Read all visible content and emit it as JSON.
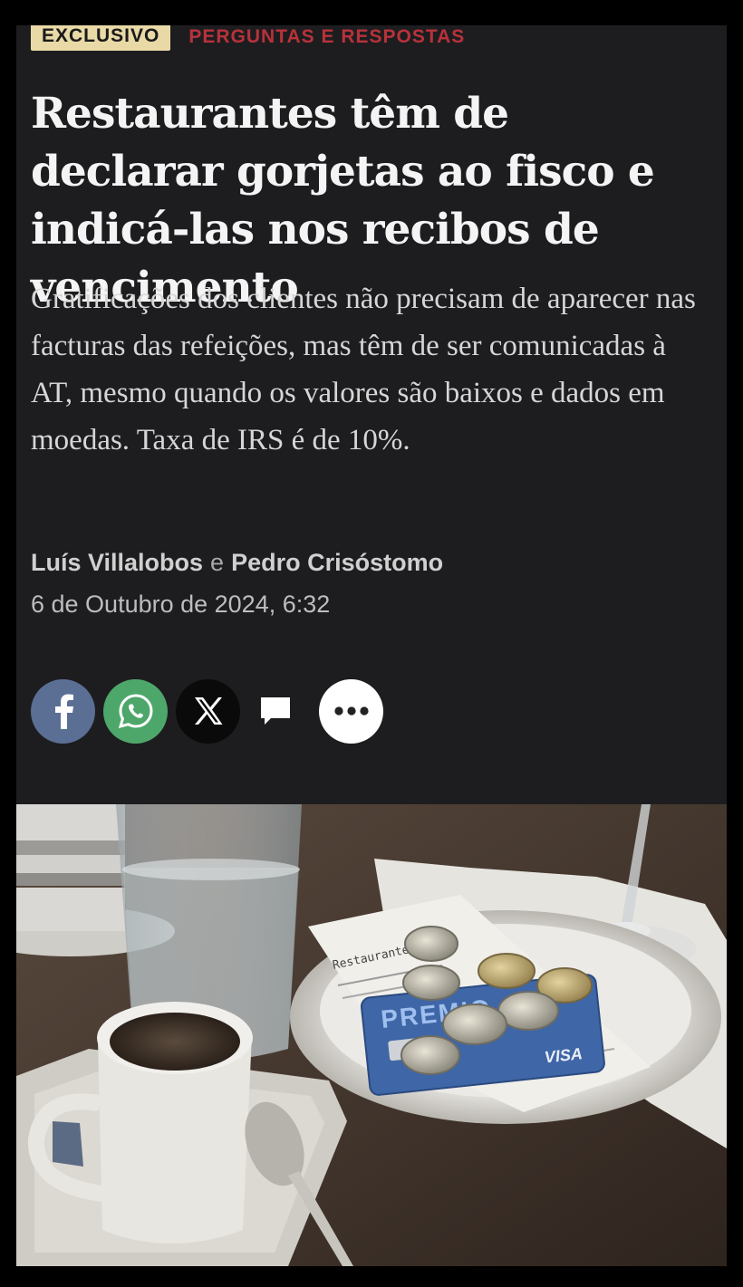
{
  "tags": {
    "exclusive": "EXCLUSIVO",
    "section": "PERGUNTAS E RESPOSTAS"
  },
  "article": {
    "headline": "Restaurantes têm de declarar gorjetas ao fisco e indicá-las nos recibos de vencimento",
    "lead": "Gratificações dos clientes não precisam de aparecer nas facturas das refeições, mas têm de ser comunicadas à AT, mesmo quando os valores são baixos e dados em moedas. Taxa de IRS é de 10%.",
    "author1": "Luís Villalobos",
    "conjunction": "e",
    "author2": "Pedro Crisóstomo",
    "date": "6 de Outubro de 2024, 6:32"
  },
  "share": {
    "buttons": [
      {
        "name": "facebook",
        "icon": "facebook-icon",
        "color": "#5b6f94"
      },
      {
        "name": "whatsapp",
        "icon": "whatsapp-icon",
        "color": "#4ea76a"
      },
      {
        "name": "x",
        "icon": "x-icon",
        "color": "#0a0a0a"
      },
      {
        "name": "comments",
        "icon": "comment-icon",
        "color": "#ffffff"
      },
      {
        "name": "more",
        "icon": "more-icon",
        "color": "#ffffff"
      }
    ]
  },
  "photo": {
    "receipt_text": "Restaurante",
    "card_text": "PREMIO",
    "card_brand": "VISA"
  },
  "colors": {
    "background": "#1d1d20",
    "exclusive_tag": "#e9d9a6",
    "section_tag": "#b8323a"
  }
}
